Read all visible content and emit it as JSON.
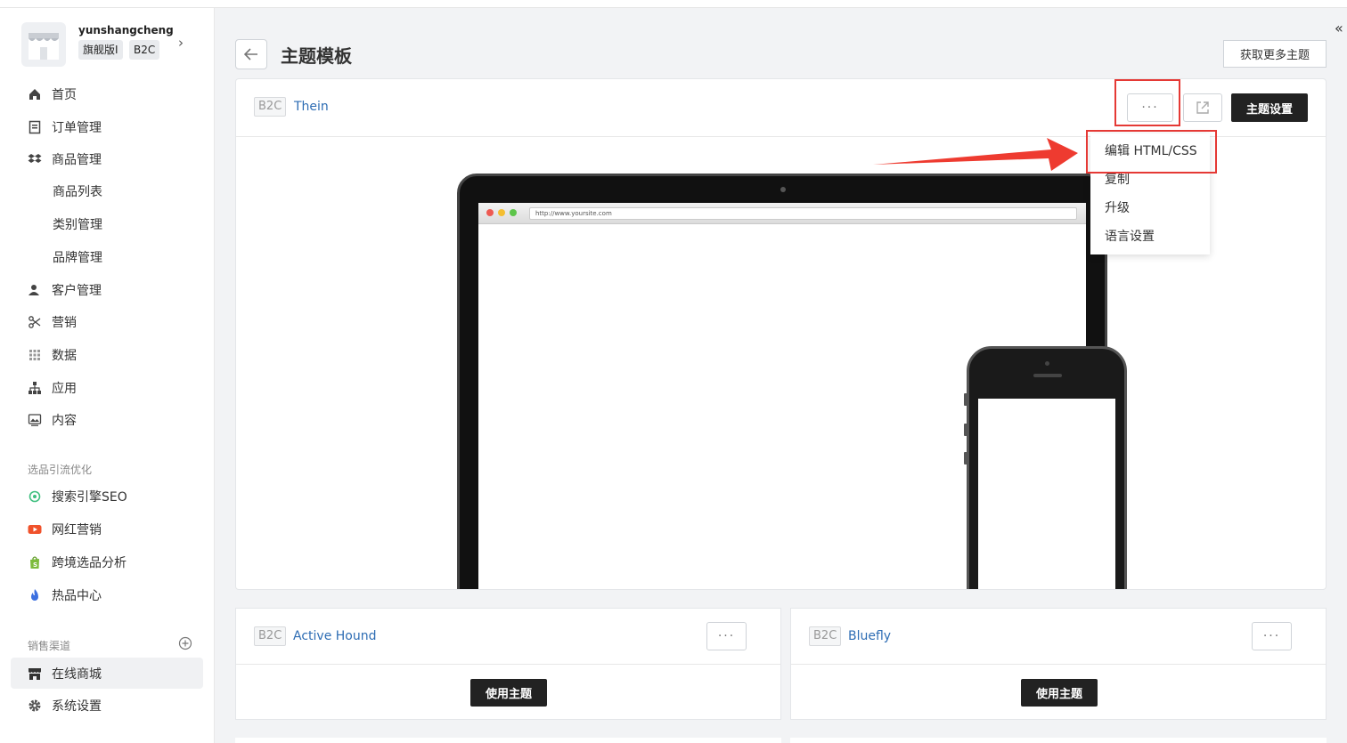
{
  "store": {
    "name": "yunshangcheng",
    "badge_plan": "旗舰版I",
    "badge_type": "B2C"
  },
  "nav": {
    "home": "首页",
    "orders": "订单管理",
    "products": "商品管理",
    "product_list": "商品列表",
    "categories": "类别管理",
    "brands": "品牌管理",
    "customers": "客户管理",
    "marketing": "营销",
    "data": "数据",
    "apps": "应用",
    "content": "内容"
  },
  "section_optimize": {
    "title": "选品引流优化",
    "seo": "搜索引擎SEO",
    "influencer": "网红营销",
    "crossborder": "跨境选品分析",
    "hot": "热品中心"
  },
  "section_channels": {
    "title": "销售渠道",
    "online_store": "在线商城",
    "settings": "系统设置"
  },
  "header": {
    "title": "主题模板",
    "more_themes": "获取更多主题"
  },
  "current_theme": {
    "tag": "B2C",
    "name": "Thein",
    "more_label": "···",
    "settings_button": "主题设置",
    "preview_url": "http://www.yoursite.com"
  },
  "dropdown": {
    "items": [
      "编辑 HTML/CSS",
      "复制",
      "升级",
      "语言设置"
    ]
  },
  "themes": [
    {
      "tag": "B2C",
      "name": "Active Hound",
      "more_label": "···",
      "use_button": "使用主题"
    },
    {
      "tag": "B2C",
      "name": "Bluefly",
      "more_label": "···",
      "use_button": "使用主题"
    }
  ],
  "colors": {
    "accent_link": "#2e6db4",
    "annotation_red": "#e53935",
    "dark_button": "#222222"
  }
}
